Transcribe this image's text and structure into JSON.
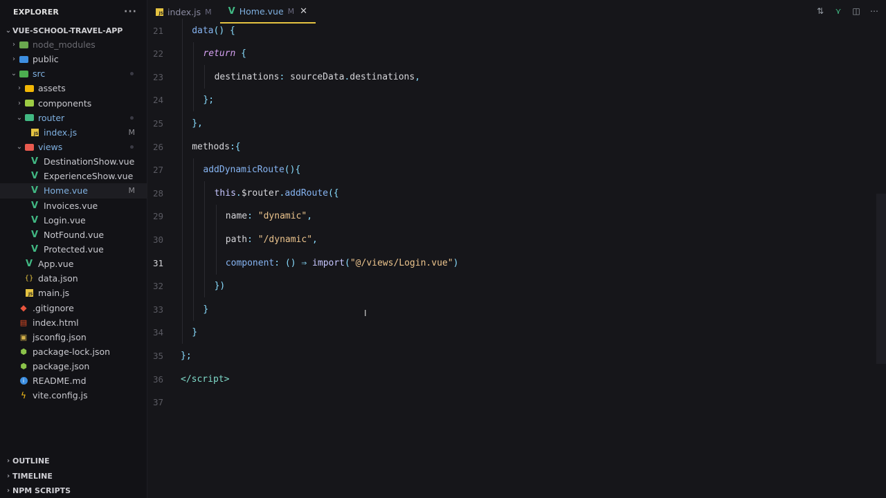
{
  "sidebar": {
    "title": "EXPLORER",
    "more": "···",
    "root": "VUE-SCHOOL-TRAVEL-APP",
    "items": [
      {
        "label": "node_modules",
        "indent": 1,
        "chev": "›",
        "icon": "node-modules-folder-icon",
        "muted": true
      },
      {
        "label": "public",
        "indent": 1,
        "chev": "›",
        "icon": "public-folder-icon"
      },
      {
        "label": "src",
        "indent": 1,
        "chev": "⌄",
        "icon": "src-folder-icon",
        "blue": true,
        "dot": true
      },
      {
        "label": "assets",
        "indent": 2,
        "chev": "›",
        "icon": "assets-folder-icon"
      },
      {
        "label": "components",
        "indent": 2,
        "chev": "›",
        "icon": "components-folder-icon"
      },
      {
        "label": "router",
        "indent": 2,
        "chev": "⌄",
        "icon": "router-folder-icon",
        "blue": true,
        "dot": true
      },
      {
        "label": "index.js",
        "indent": 3,
        "icon": "js-file-icon",
        "blue": true,
        "badge": "M"
      },
      {
        "label": "views",
        "indent": 2,
        "chev": "⌄",
        "icon": "views-folder-icon",
        "blue": true,
        "dot": true
      },
      {
        "label": "DestinationShow.vue",
        "indent": 3,
        "icon": "vue-file-icon"
      },
      {
        "label": "ExperienceShow.vue",
        "indent": 3,
        "icon": "vue-file-icon"
      },
      {
        "label": "Home.vue",
        "indent": 3,
        "icon": "vue-file-icon",
        "blue": true,
        "badge": "M",
        "active": true
      },
      {
        "label": "Invoices.vue",
        "indent": 3,
        "icon": "vue-file-icon"
      },
      {
        "label": "Login.vue",
        "indent": 3,
        "icon": "vue-file-icon"
      },
      {
        "label": "NotFound.vue",
        "indent": 3,
        "icon": "vue-file-icon"
      },
      {
        "label": "Protected.vue",
        "indent": 3,
        "icon": "vue-file-icon"
      },
      {
        "label": "App.vue",
        "indent": 2,
        "icon": "vue-file-icon"
      },
      {
        "label": "data.json",
        "indent": 2,
        "icon": "json-braces-icon"
      },
      {
        "label": "main.js",
        "indent": 2,
        "icon": "js-file-icon"
      },
      {
        "label": ".gitignore",
        "indent": 1,
        "icon": "git-icon"
      },
      {
        "label": "index.html",
        "indent": 1,
        "icon": "html-file-icon"
      },
      {
        "label": "jsconfig.json",
        "indent": 1,
        "icon": "jsconfig-icon"
      },
      {
        "label": "package-lock.json",
        "indent": 1,
        "icon": "npm-lock-icon"
      },
      {
        "label": "package.json",
        "indent": 1,
        "icon": "npm-icon"
      },
      {
        "label": "README.md",
        "indent": 1,
        "icon": "info-icon"
      },
      {
        "label": "vite.config.js",
        "indent": 1,
        "icon": "vite-icon"
      }
    ],
    "sections": [
      "OUTLINE",
      "TIMELINE",
      "NPM SCRIPTS"
    ]
  },
  "tabs": [
    {
      "label": "index.js",
      "badge": "M",
      "icon": "js-file-icon"
    },
    {
      "label": "Home.vue",
      "badge": "M",
      "icon": "vue-file-icon",
      "active": true,
      "close": "✕"
    }
  ],
  "toolbar_icons": [
    "compare-changes-icon",
    "vue-extension-icon",
    "split-editor-icon",
    "more-actions-icon"
  ],
  "editor": {
    "current_line": 31,
    "lines": [
      {
        "n": 21,
        "indent": 1,
        "tokens": [
          [
            "fn",
            "data"
          ],
          [
            "pun",
            "() {"
          ]
        ]
      },
      {
        "n": 22,
        "indent": 2,
        "tokens": [
          [
            "kw",
            "return"
          ],
          [
            "pun",
            " {"
          ]
        ]
      },
      {
        "n": 23,
        "indent": 3,
        "tokens": [
          [
            "prop",
            "destinations"
          ],
          [
            "pun",
            ": "
          ],
          [
            "prop",
            "sourceData"
          ],
          [
            "pun",
            "."
          ],
          [
            "prop",
            "destinations"
          ],
          [
            "pun",
            ","
          ]
        ]
      },
      {
        "n": 24,
        "indent": 2,
        "tokens": [
          [
            "pun",
            "};"
          ]
        ]
      },
      {
        "n": 25,
        "indent": 1,
        "tokens": [
          [
            "pun",
            "},"
          ]
        ]
      },
      {
        "n": 26,
        "indent": 1,
        "tokens": [
          [
            "prop",
            "methods"
          ],
          [
            "pun",
            ":{"
          ]
        ]
      },
      {
        "n": 27,
        "indent": 2,
        "tokens": [
          [
            "fn",
            "addDynamicRoute"
          ],
          [
            "pun",
            "(){"
          ]
        ]
      },
      {
        "n": 28,
        "indent": 3,
        "tokens": [
          [
            "k",
            "this"
          ],
          [
            "pun",
            "."
          ],
          [
            "prop",
            "$router"
          ],
          [
            "pun",
            "."
          ],
          [
            "fn",
            "addRoute"
          ],
          [
            "pun",
            "({"
          ]
        ]
      },
      {
        "n": 29,
        "indent": 4,
        "tokens": [
          [
            "prop",
            "name"
          ],
          [
            "pun",
            ": "
          ],
          [
            "str",
            "\"dynamic\""
          ],
          [
            "pun",
            ","
          ]
        ]
      },
      {
        "n": 30,
        "indent": 4,
        "tokens": [
          [
            "prop",
            "path"
          ],
          [
            "pun",
            ": "
          ],
          [
            "str",
            "\"/dynamic\""
          ],
          [
            "pun",
            ","
          ]
        ]
      },
      {
        "n": 31,
        "indent": 4,
        "tokens": [
          [
            "fn",
            "component"
          ],
          [
            "pun",
            ": () ⇒ "
          ],
          [
            "k",
            "import"
          ],
          [
            "pun",
            "("
          ],
          [
            "str",
            "\"@/views/Login.vue\""
          ],
          [
            "pun",
            ")"
          ]
        ]
      },
      {
        "n": 32,
        "indent": 3,
        "tokens": [
          [
            "pun",
            "})"
          ]
        ]
      },
      {
        "n": 33,
        "indent": 2,
        "tokens": [
          [
            "pun",
            "}"
          ]
        ]
      },
      {
        "n": 34,
        "indent": 1,
        "tokens": [
          [
            "pun",
            "}"
          ]
        ]
      },
      {
        "n": 35,
        "indent": 0,
        "tokens": [
          [
            "pun",
            "};"
          ]
        ]
      },
      {
        "n": 36,
        "indent": 0,
        "tokens": [
          [
            "tag",
            "</"
          ],
          [
            "tag",
            "script"
          ],
          [
            "tag",
            ">"
          ]
        ]
      },
      {
        "n": 37,
        "indent": 0,
        "tokens": []
      }
    ]
  },
  "colors": {
    "accent": "#7fb0e0",
    "vue": "#41b883",
    "js": "#e5c341",
    "string": "#ecc48d",
    "function": "#86b4f2"
  }
}
